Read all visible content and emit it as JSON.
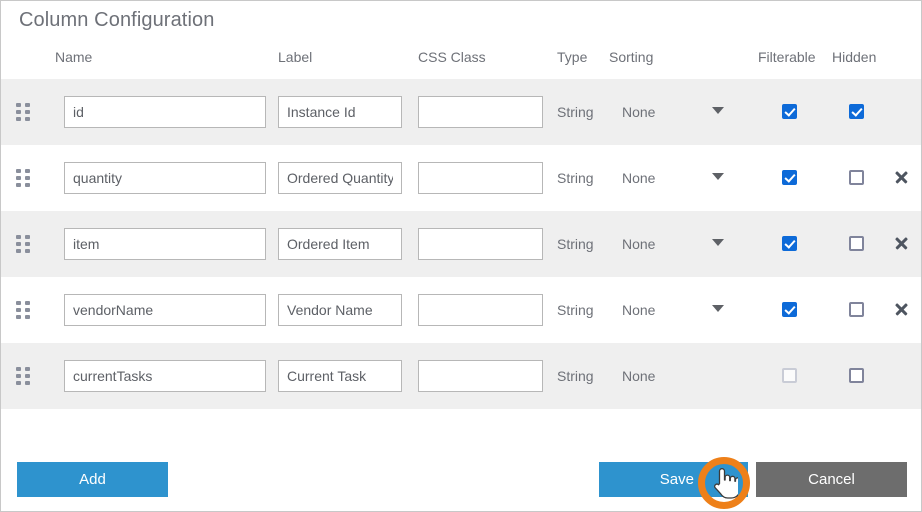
{
  "panel": {
    "title": "Column Configuration"
  },
  "table": {
    "headers": [
      {
        "key": "name",
        "label": "Name"
      },
      {
        "key": "label",
        "label": "Label"
      },
      {
        "key": "css_class",
        "label": "CSS Class"
      },
      {
        "key": "type",
        "label": "Type"
      },
      {
        "key": "sorting",
        "label": "Sorting"
      },
      {
        "key": "filterable",
        "label": "Filterable"
      },
      {
        "key": "hidden",
        "label": "Hidden"
      }
    ],
    "rows": [
      {
        "name": "id",
        "label": "Instance Id",
        "css_class": "",
        "css_placeholder": "",
        "type": "String",
        "sorting": "None",
        "has_sorting_dropdown": true,
        "filterable": true,
        "filterable_disabled": false,
        "hidden": true,
        "removable": false
      },
      {
        "name": "quantity",
        "label": "Ordered Quantity",
        "css_class": "",
        "css_placeholder": "",
        "type": "String",
        "sorting": "None",
        "has_sorting_dropdown": true,
        "filterable": true,
        "filterable_disabled": false,
        "hidden": false,
        "removable": true
      },
      {
        "name": "item",
        "label": "Ordered Item",
        "css_class": "",
        "css_placeholder": "",
        "type": "String",
        "sorting": "None",
        "has_sorting_dropdown": true,
        "filterable": true,
        "filterable_disabled": false,
        "hidden": false,
        "removable": true
      },
      {
        "name": "vendorName",
        "label": "Vendor Name",
        "css_class": "",
        "css_placeholder": "",
        "type": "String",
        "sorting": "None",
        "has_sorting_dropdown": true,
        "filterable": true,
        "filterable_disabled": false,
        "hidden": false,
        "removable": true
      },
      {
        "name": "currentTasks",
        "label": "Current Task",
        "css_class": "",
        "css_placeholder": "",
        "type": "String",
        "sorting": "None",
        "has_sorting_dropdown": false,
        "filterable": false,
        "filterable_disabled": true,
        "hidden": false,
        "removable": false
      }
    ]
  },
  "footer": {
    "add_label": "Add",
    "save_label": "Save",
    "cancel_label": "Cancel"
  },
  "cursor": {
    "icon": "pointing-hand-cursor",
    "highlight_color": "#ee8019"
  },
  "colors": {
    "accent_blue": "#2e93ce",
    "checkbox_blue": "#0d6ad8",
    "cancel_gray": "#6d6d6d",
    "row_alt": "#efefef",
    "text_gray": "#6e7178"
  }
}
